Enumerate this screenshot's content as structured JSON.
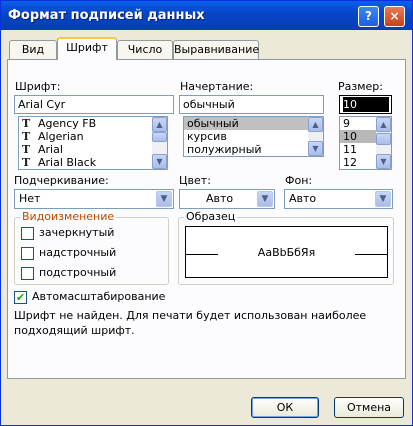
{
  "window": {
    "title": "Формат подписей данных",
    "help_label": "?",
    "close_label": "×"
  },
  "tabs": [
    {
      "label": "Вид"
    },
    {
      "label": "Шрифт"
    },
    {
      "label": "Число"
    },
    {
      "label": "Выравнивание"
    }
  ],
  "font": {
    "label": "Шрифт:",
    "value": "Arial Cyr",
    "icon_glyph": "T",
    "items": [
      "Agency FB",
      "Algerian",
      "Arial",
      "Arial Black"
    ]
  },
  "style": {
    "label": "Начертание:",
    "value": "обычный",
    "items": [
      "обычный",
      "курсив",
      "полужирный"
    ]
  },
  "size": {
    "label": "Размер:",
    "value": "10",
    "items": [
      "9",
      "10",
      "11",
      "12"
    ]
  },
  "underline": {
    "label": "Подчеркивание:",
    "value": "Нет"
  },
  "color": {
    "label": "Цвет:",
    "value": "Авто"
  },
  "background": {
    "label": "Фон:",
    "value": "Авто"
  },
  "effects": {
    "title": "Видоизменение",
    "strikethrough": "зачеркнутый",
    "superscript": "надстрочный",
    "subscript": "подстрочный"
  },
  "preview": {
    "title": "Образец",
    "sample": "АаBbБбЯя"
  },
  "autoscale": {
    "label": "Автомасштабирование",
    "checked": true
  },
  "note": "Шрифт не найден. Для печати будет использован наиболее подходящий шрифт.",
  "buttons": {
    "ok": "ОК",
    "cancel": "Отмена"
  },
  "icons": {
    "up": "▲",
    "down": "▼",
    "check": "✔"
  }
}
